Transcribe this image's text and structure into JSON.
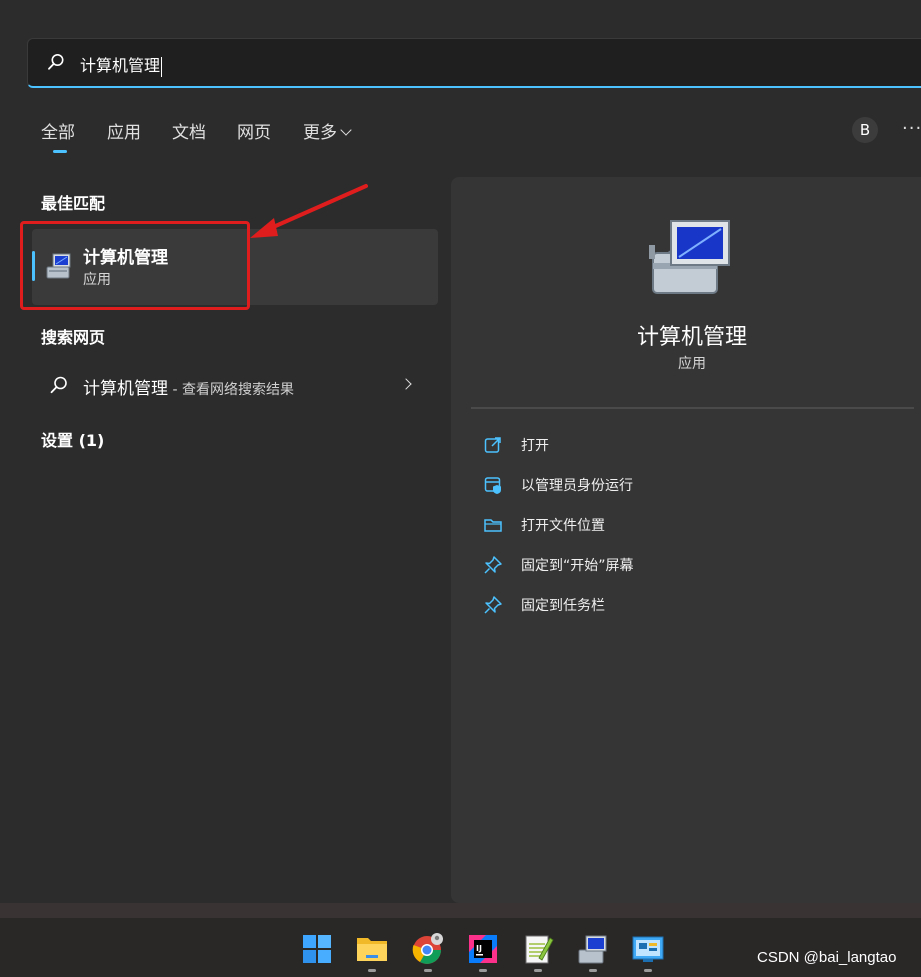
{
  "search": {
    "value": "计算机管理"
  },
  "tabs": [
    {
      "label": "全部",
      "active": true
    },
    {
      "label": "应用"
    },
    {
      "label": "文档"
    },
    {
      "label": "网页"
    },
    {
      "label": "更多"
    }
  ],
  "header": {
    "avatar_letter": "B",
    "more_glyph": "···"
  },
  "sections": {
    "best_match": "最佳匹配",
    "search_web": "搜索网页",
    "settings": "设置 (1)"
  },
  "best_match_item": {
    "name": "计算机管理",
    "type": "应用"
  },
  "web_result": {
    "query": "计算机管理",
    "suffix": " - 查看网络搜索结果"
  },
  "detail": {
    "name": "计算机管理",
    "type": "应用",
    "actions": [
      {
        "label": "打开",
        "icon": "open-external-icon"
      },
      {
        "label": "以管理员身份运行",
        "icon": "admin-shield-icon"
      },
      {
        "label": "打开文件位置",
        "icon": "folder-icon"
      },
      {
        "label": "固定到“开始”屏幕",
        "icon": "pin-icon"
      },
      {
        "label": "固定到任务栏",
        "icon": "pin-icon"
      }
    ]
  },
  "taskbar": {
    "apps": [
      "windows-start-icon",
      "file-explorer-icon",
      "chrome-icon",
      "intellij-icon",
      "notepad-plus-icon",
      "computer-management-icon",
      "remote-desktop-icon"
    ]
  },
  "watermark": "CSDN @bai_langtao",
  "colors": {
    "accent": "#4cc2ff",
    "highlight": "#e01d1d"
  }
}
